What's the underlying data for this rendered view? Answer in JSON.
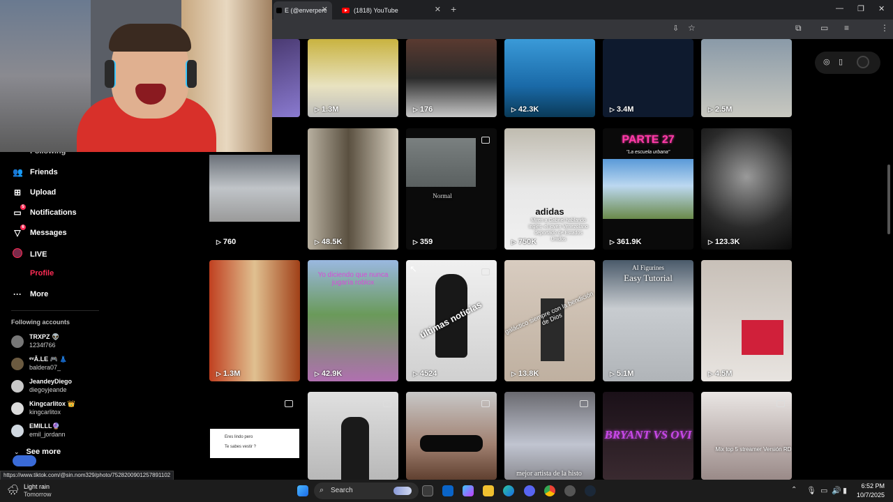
{
  "browser": {
    "tabs": [
      {
        "label": "E (@enverperoz"
      },
      {
        "label": "(1818) YouTube"
      }
    ],
    "new_tab": "+",
    "window_controls": {
      "minimize": "—",
      "maximize": "❐",
      "close": "✕"
    }
  },
  "sidebar": {
    "partial_item": "Following",
    "items": [
      {
        "label": "Friends",
        "icon": "friends-icon"
      },
      {
        "label": "Upload",
        "icon": "upload-icon"
      },
      {
        "label": "Notifications",
        "icon": "notifications-icon",
        "badge": "5"
      },
      {
        "label": "Messages",
        "icon": "messages-icon",
        "badge": "6"
      },
      {
        "label": "LIVE",
        "icon": "live-icon"
      },
      {
        "label": "Profile",
        "icon": "profile-avatar"
      },
      {
        "label": "More",
        "icon": "more-icon"
      }
    ],
    "following_title": "Following accounts",
    "accounts": [
      {
        "name": "TRXPZ 👽",
        "handle": "1234f766"
      },
      {
        "name": "ᵉᵛĀ.LE 🎮 👗",
        "handle": "baldera07_"
      },
      {
        "name": "JeandeyDiego",
        "handle": "diegoyjeande"
      },
      {
        "name": "Kingcarlitox 👑",
        "handle": "kingcarlitox"
      },
      {
        "name": "EMILLL🔮",
        "handle": "emil_jordann"
      }
    ],
    "see_more": "See more",
    "status_url": "https://www.tiktok.com/@sin.nom329/photo/7528200901257891102"
  },
  "grid": {
    "row1": [
      "1.3M",
      "176",
      "42.3K",
      "3.4M",
      "2.5M"
    ],
    "row2": [
      "760",
      "48.5K",
      "359",
      "750K",
      "361.9K",
      "123.3K"
    ],
    "row3": [
      "1.3M",
      "42.9K",
      "4524",
      "13.8K",
      "5.1M",
      "4.5M"
    ],
    "captions": {
      "normal": "Normal",
      "adidas": "adidas",
      "adidas_sub": "Miren a Gabriel hablando inglés, el joven Venezolano deportado de Estados Unidos",
      "parte": "PARTE 27",
      "escuela": "\"La escuela urbana\"",
      "roblox": "Yo diciendo que nunca jugaría roblox",
      "noticias": "últimas noticias",
      "galactico": "galáctico siempre con la bendición de Dios",
      "figurines": "AI Figurines",
      "easy": "Easy Tutorial",
      "eres1": "Eres lindo pero",
      "eres2": "Te sabes vestir ?",
      "bryant": "BRYANT VS OVI",
      "mix": "Mix top 5 streamer Versión RD",
      "artista": "mejor artista de la histo"
    }
  },
  "taskbar": {
    "weather_temp": "Light rain",
    "weather_day": "Tomorrow",
    "search": "Search",
    "time": "6:52 PM",
    "date": "10/7/2025"
  }
}
